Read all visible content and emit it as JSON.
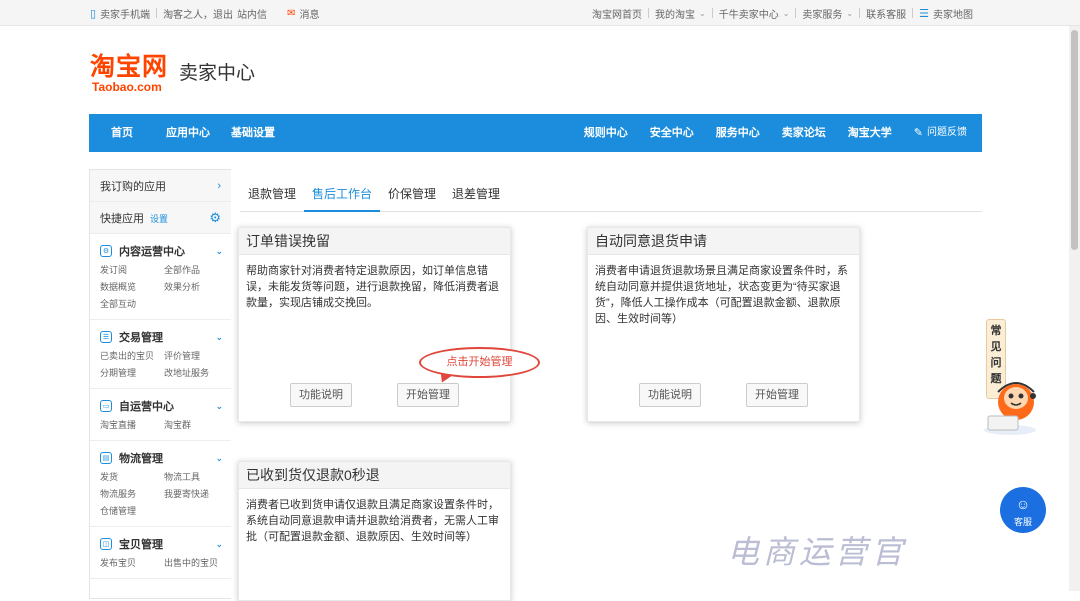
{
  "topbar": {
    "mobile": "卖家手机端",
    "user": "淘客之人，退出",
    "inbox": "站内信",
    "messages": "消息",
    "home": "淘宝网首页",
    "my_taobao": "我的淘宝",
    "qianniu": "千牛卖家中心",
    "seller_service": "卖家服务",
    "contact": "联系客服",
    "sitemap": "卖家地图"
  },
  "logo": {
    "main": "淘宝网",
    "sub": "Taobao.com",
    "title": "卖家中心"
  },
  "nav": {
    "left": [
      "首页",
      "应用中心",
      "基础设置"
    ],
    "right": [
      "规则中心",
      "安全中心",
      "服务中心",
      "卖家论坛",
      "淘宝大学"
    ],
    "feedback": "问题反馈"
  },
  "sidebar": {
    "my_apps": "我订购的应用",
    "quick": "快捷应用",
    "quick_setting": "设置",
    "sections": [
      {
        "title": "内容运营中心",
        "links": [
          "发订阅",
          "全部作品",
          "数据概览",
          "效果分析",
          "全部互动"
        ]
      },
      {
        "title": "交易管理",
        "links": [
          "已卖出的宝贝",
          "评价管理",
          "分期管理",
          "改地址服务"
        ]
      },
      {
        "title": "自运营中心",
        "links": [
          "淘宝直播",
          "淘宝群"
        ]
      },
      {
        "title": "物流管理",
        "links": [
          "发货",
          "物流工具",
          "物流服务",
          "我要寄快递",
          "仓储管理"
        ]
      },
      {
        "title": "宝贝管理",
        "links": [
          "发布宝贝",
          "出售中的宝贝"
        ]
      }
    ]
  },
  "tabs": [
    "退款管理",
    "售后工作台",
    "价保管理",
    "退差管理"
  ],
  "active_tab": 1,
  "cards": [
    {
      "title": "订单错误挽留",
      "desc": "帮助商家针对消费者特定退款原因，如订单信息错误，未能发货等问题，进行退款挽留，降低消费者退款量，实现店铺成交挽回。",
      "btn1": "功能说明",
      "btn2": "开始管理"
    },
    {
      "title": "自动同意退货申请",
      "desc": "消费者申请退货退款场景且满足商家设置条件时，系统自动同意并提供退货地址，状态变更为“待买家退货”，降低人工操作成本（可配置退款金额、退款原因、生效时间等）",
      "btn1": "功能说明",
      "btn2": "开始管理"
    },
    {
      "title": "已收到货仅退款0秒退",
      "desc": "消费者已收到货申请仅退款且满足商家设置条件时，系统自动同意退款申请并退款给消费者，无需人工审批（可配置退款金额、退款原因、生效时间等）"
    }
  ],
  "annotation": "点击开始管理",
  "faq": "常见问题",
  "chat": "客服",
  "watermark": "电商运营官",
  "colors": {
    "accent": "#1b8ddc",
    "brand": "#ff4400",
    "annotation": "#e0463a"
  }
}
